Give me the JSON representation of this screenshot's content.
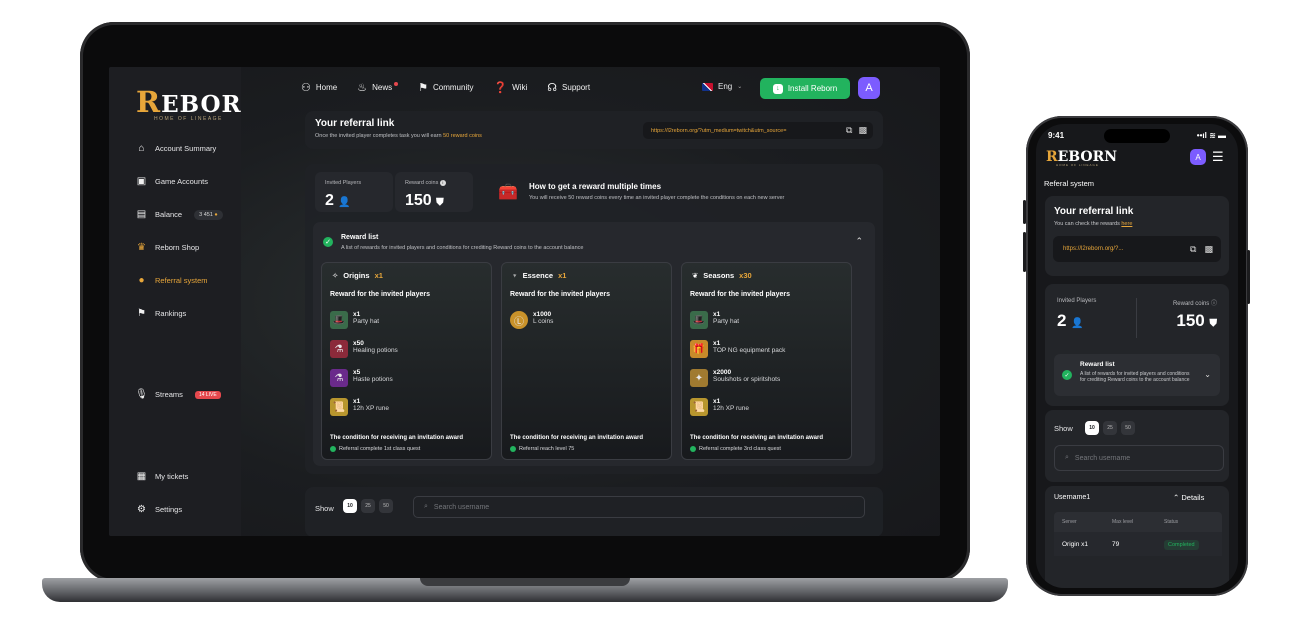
{
  "brand": {
    "logo": "REBORN",
    "logo_first": "R",
    "logo_rest": "EBORN",
    "tagline": "HOME OF LINEAGE"
  },
  "sidebar": {
    "items": [
      {
        "label": "Account Summary",
        "icon": "home-icon"
      },
      {
        "label": "Game Accounts",
        "icon": "gamepad-icon"
      },
      {
        "label": "Balance",
        "icon": "wallet-icon",
        "badge": "3 451"
      },
      {
        "label": "Reborn Shop",
        "icon": "crown-icon"
      },
      {
        "label": "Referral system",
        "icon": "user-icon",
        "active": true
      },
      {
        "label": "Rankings",
        "icon": "flag-icon"
      },
      {
        "label": "Streams",
        "icon": "mic-icon",
        "badge": "14 LIVE"
      },
      {
        "label": "My tickets",
        "icon": "ticket-icon"
      },
      {
        "label": "Settings",
        "icon": "gear-icon"
      }
    ]
  },
  "topnav": {
    "items": [
      {
        "label": "Home",
        "icon": "nodes-icon"
      },
      {
        "label": "News",
        "icon": "fire-icon"
      },
      {
        "label": "Community",
        "icon": "flag-icon"
      },
      {
        "label": "Wiki",
        "icon": "question-icon"
      },
      {
        "label": "Support",
        "icon": "headset-icon"
      }
    ],
    "language": "Eng",
    "install_label": "Install Reborn",
    "avatar_letter": "A"
  },
  "referral": {
    "title": "Your referral link",
    "subtitle_prefix": "Once the invited player completes task you will earn",
    "subtitle_highlight": "50 reward coins",
    "link": "https://l2reborn.org/?utm_medium=twitch&utm_source="
  },
  "stats": {
    "invited_label": "Invited Players",
    "invited_value": "2",
    "coins_label": "Reward coins",
    "coins_value": "150",
    "how_title": "How to get a reward multiple times",
    "how_subtitle": "You will receive 50 reward coins every time an invited player complete the conditions on each new server"
  },
  "reward_list": {
    "title": "Reward list",
    "subtitle": "A list of rewards for invited players and conditions for crediting Reward coins to the account balance",
    "rewards_heading": "Reward for the invited players",
    "condition_heading": "The condition for receiving an invitation award",
    "servers": [
      {
        "name": "Origins",
        "multiplier": "x1",
        "items": [
          {
            "qty": "x1",
            "name": "Party hat",
            "color": "#3a6b4a"
          },
          {
            "qty": "x50",
            "name": "Healing potions",
            "color": "#8b2a3a"
          },
          {
            "qty": "x5",
            "name": "Haste potions",
            "color": "#6a2a8b"
          },
          {
            "qty": "x1",
            "name": "12h XP rune",
            "color": "#b8962e"
          }
        ],
        "condition": "Referral complete 1st class quest"
      },
      {
        "name": "Essence",
        "multiplier": "x1",
        "items": [
          {
            "qty": "x1000",
            "name": "L coins",
            "color": "#c9922a"
          }
        ],
        "condition": "Referral reach level 75"
      },
      {
        "name": "Seasons",
        "multiplier": "x30",
        "items": [
          {
            "qty": "x1",
            "name": "Party hat",
            "color": "#3a6b4a"
          },
          {
            "qty": "x1",
            "name": "TOP NG equipment pack",
            "color": "#c78a2a"
          },
          {
            "qty": "x2000",
            "name": "Soulshots or spiritshots",
            "color": "#a07a30"
          },
          {
            "qty": "x1",
            "name": "12h XP rune",
            "color": "#b8962e"
          }
        ],
        "condition": "Referral complete 3rd class quest"
      }
    ]
  },
  "table_controls": {
    "show_label": "Show",
    "page_sizes": [
      "10",
      "25",
      "50"
    ],
    "search_placeholder": "Search username"
  },
  "phone": {
    "time": "9:41",
    "status_icons": "••ıl ≋ ▬",
    "page_title": "Referal system",
    "ref_title": "Your referral link",
    "ref_sub_prefix": "You can check the rewards",
    "ref_sub_link": "here",
    "link": "https://l2reborn.org/?...",
    "invited_label": "Invited Players",
    "invited_value": "2",
    "coins_label": "Reward coins",
    "coins_value": "150",
    "reward_title": "Reward list",
    "reward_sub": "A list of rewards for invited players and conditions for crediting Reward coins to the account balance",
    "show_label": "Show",
    "page_sizes": [
      "10",
      "25",
      "50"
    ],
    "search_placeholder": "Search username",
    "user": "Username1",
    "details_label": "Details",
    "table_headers": [
      "Server",
      "Max level",
      "Status"
    ],
    "table_row": {
      "server": "Origin x1",
      "level": "79",
      "status": "Completed"
    }
  },
  "colors": {
    "accent": "#e7a63a",
    "success": "#22b35e",
    "avatar": "#7c5cff",
    "live": "#e5484d"
  }
}
